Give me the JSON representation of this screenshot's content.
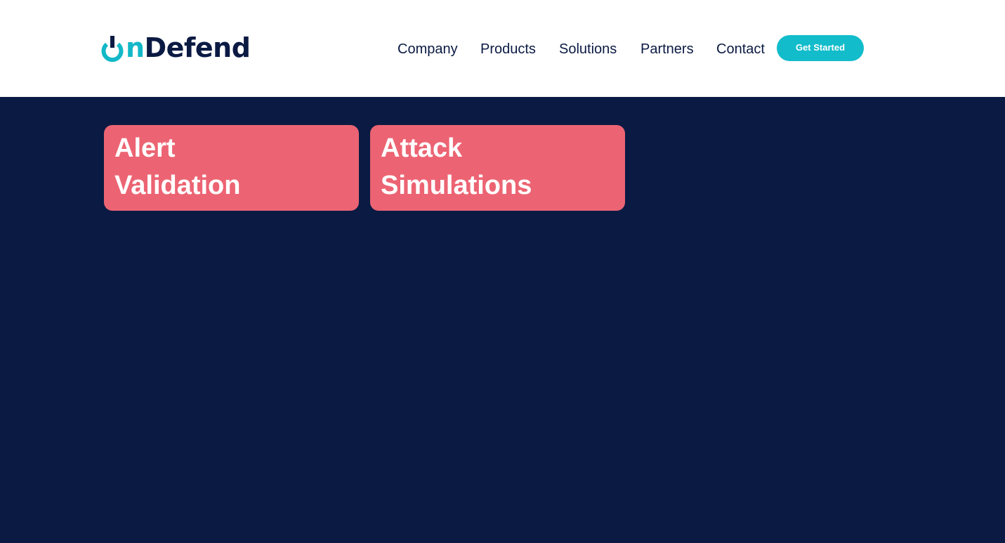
{
  "colors": {
    "brand_dark": "#0b1a43",
    "brand_teal": "#12b8c8",
    "card_red": "#ec6473",
    "header_bg": "#ffffff"
  },
  "header": {
    "logo": {
      "icon": "power-icon",
      "text_accent": "n",
      "text_main": "Defend"
    },
    "nav": [
      {
        "label": "Company"
      },
      {
        "label": "Products"
      },
      {
        "label": "Solutions"
      },
      {
        "label": "Partners"
      },
      {
        "label": "Contact"
      }
    ],
    "cta_label": "Get Started"
  },
  "cards": [
    {
      "line1": "Alert",
      "line2": "Validation"
    },
    {
      "line1": "Attack",
      "line2": "Simulations"
    }
  ]
}
